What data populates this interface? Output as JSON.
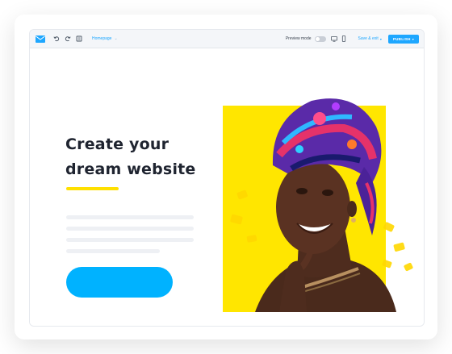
{
  "toolbar": {
    "page_selector": "Homepage",
    "preview_label": "Preview mode",
    "save_exit": "Save & exit",
    "publish": "PUBLISH"
  },
  "hero": {
    "headline_line1": "Create your",
    "headline_line2": "dream website"
  },
  "colors": {
    "accent_blue": "#1ea7ff",
    "cta_blue": "#00b2ff",
    "accent_yellow": "#ffe600",
    "headline": "#1f2430"
  },
  "icons": [
    "mail-logo-icon",
    "undo-icon",
    "redo-icon",
    "pages-icon",
    "chevron-down-icon",
    "desktop-icon",
    "mobile-icon"
  ]
}
